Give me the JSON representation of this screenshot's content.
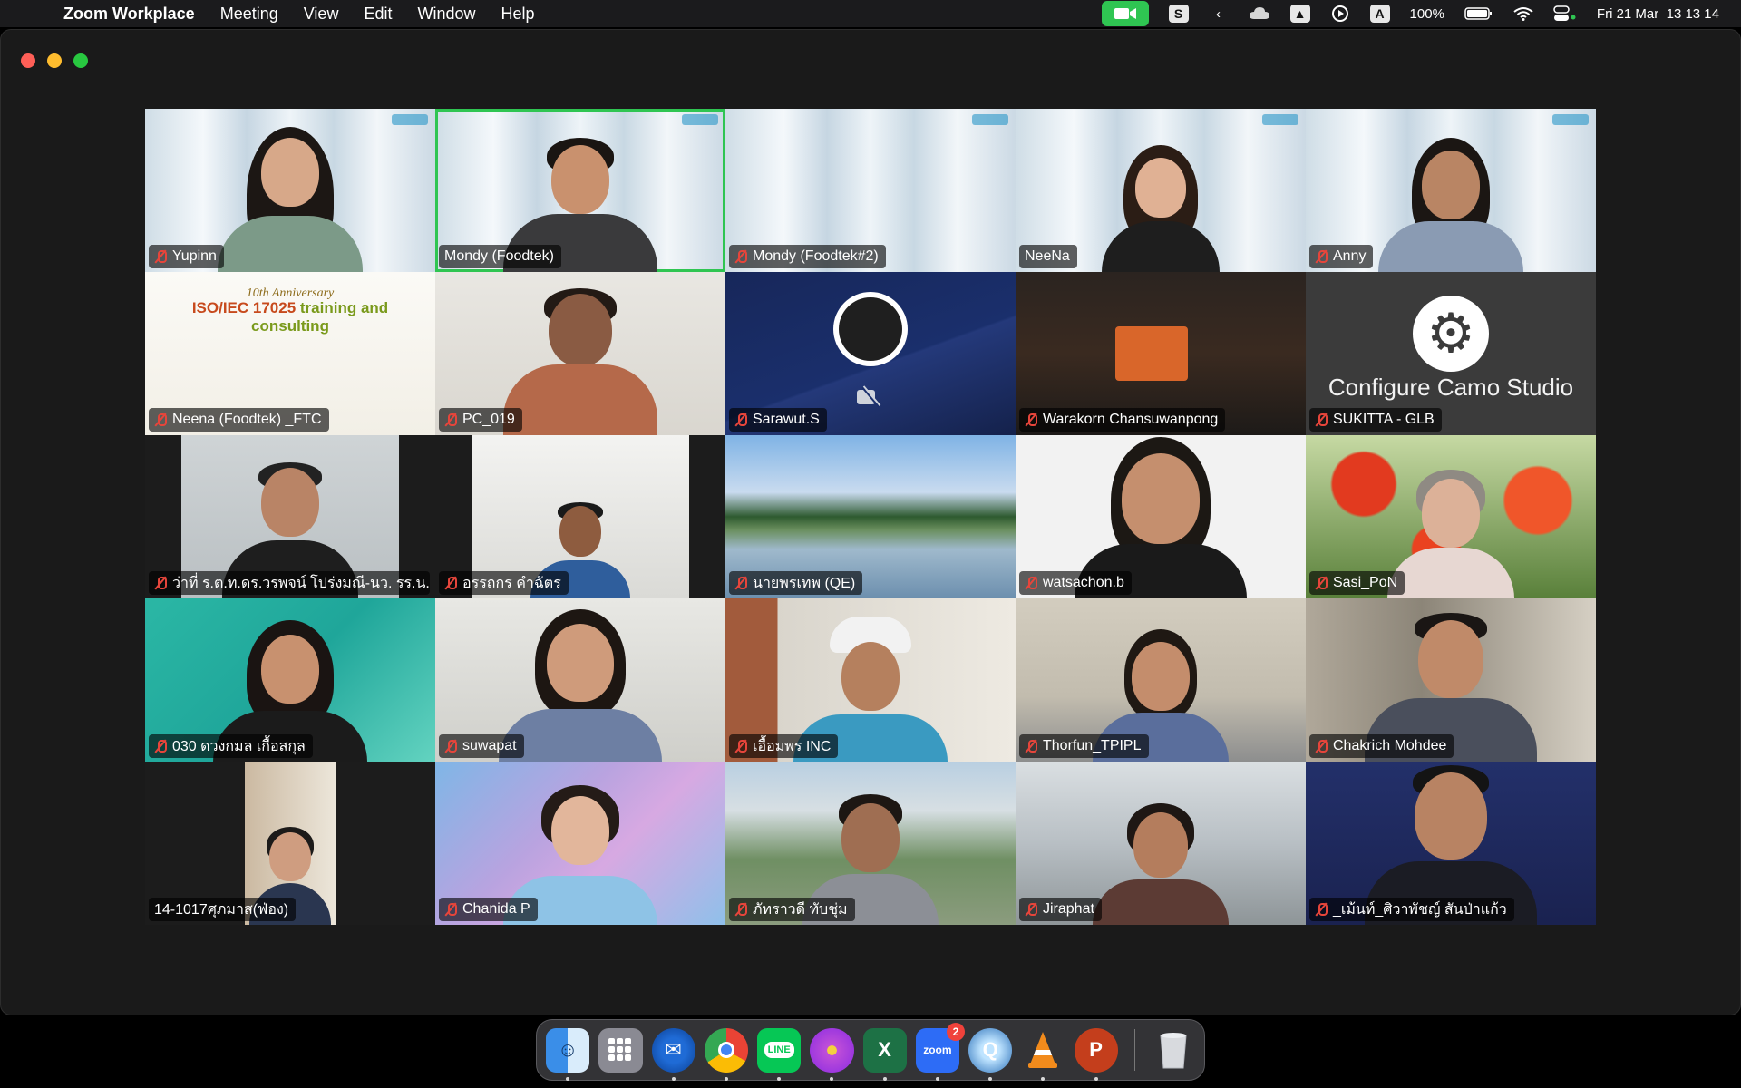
{
  "menubar": {
    "app_name": "Zoom Workplace",
    "items": [
      "Meeting",
      "View",
      "Edit",
      "Window",
      "Help"
    ],
    "battery": "100%",
    "datetime": "Fri 21 Mar  13 13 14"
  },
  "participants": [
    {
      "name": "Yupinn",
      "muted": true
    },
    {
      "name": "Mondy (Foodtek)",
      "muted": false,
      "active_speaker": true
    },
    {
      "name": "Mondy (Foodtek#2)",
      "muted": true
    },
    {
      "name": "NeeNa",
      "muted": false
    },
    {
      "name": "Anny",
      "muted": true
    },
    {
      "name": "Neena (Foodtek) _FTC",
      "muted": true
    },
    {
      "name": "PC_019",
      "muted": true
    },
    {
      "name": "Sarawut.S",
      "muted": true
    },
    {
      "name": "Warakorn Chansuwanpong",
      "muted": true
    },
    {
      "name": "SUKITTA - GLB",
      "muted": true
    },
    {
      "name": "ว่าที่ ร.ต.ท.ดร.วรพจน์ โปร่งมณี-นว. รร.น...",
      "muted": true
    },
    {
      "name": "อรรถกร คำฉัตร",
      "muted": true
    },
    {
      "name": "นายพรเทพ (QE)",
      "muted": true
    },
    {
      "name": "watsachon.b",
      "muted": true
    },
    {
      "name": "Sasi_PoN",
      "muted": true
    },
    {
      "name": "030 ดวงกมล  เกื้อสกุล",
      "muted": true
    },
    {
      "name": "suwapat",
      "muted": true
    },
    {
      "name": "เอื้อมพร INC",
      "muted": true
    },
    {
      "name": "Thorfun_TPIPL",
      "muted": true
    },
    {
      "name": "Chakrich Mohdee",
      "muted": true
    },
    {
      "name": "14-1017ศุภมาส(ฟ่อง)",
      "muted": false
    },
    {
      "name": "Chanida P",
      "muted": true
    },
    {
      "name": "ภัทราวดี ทับชุ่ม",
      "muted": true
    },
    {
      "name": "Jiraphat",
      "muted": true
    },
    {
      "name": "_เม้นท์_ศิวาพัชญ์ สันป่าแก้ว",
      "muted": true
    }
  ],
  "tile_content": {
    "banner_anniversary": "10th Anniversary",
    "banner_title_a": "ISO/IEC 17025",
    "banner_title_b": " training and consulting",
    "camo_text": "Configure Camo Studio"
  },
  "dock": {
    "zoom_label": "zoom",
    "zoom_badge": "2",
    "line_label": "LINE"
  },
  "colors": {
    "active_speaker": "#2fc552",
    "mute": "#e6453b",
    "menubar": "#1b1b1d"
  }
}
